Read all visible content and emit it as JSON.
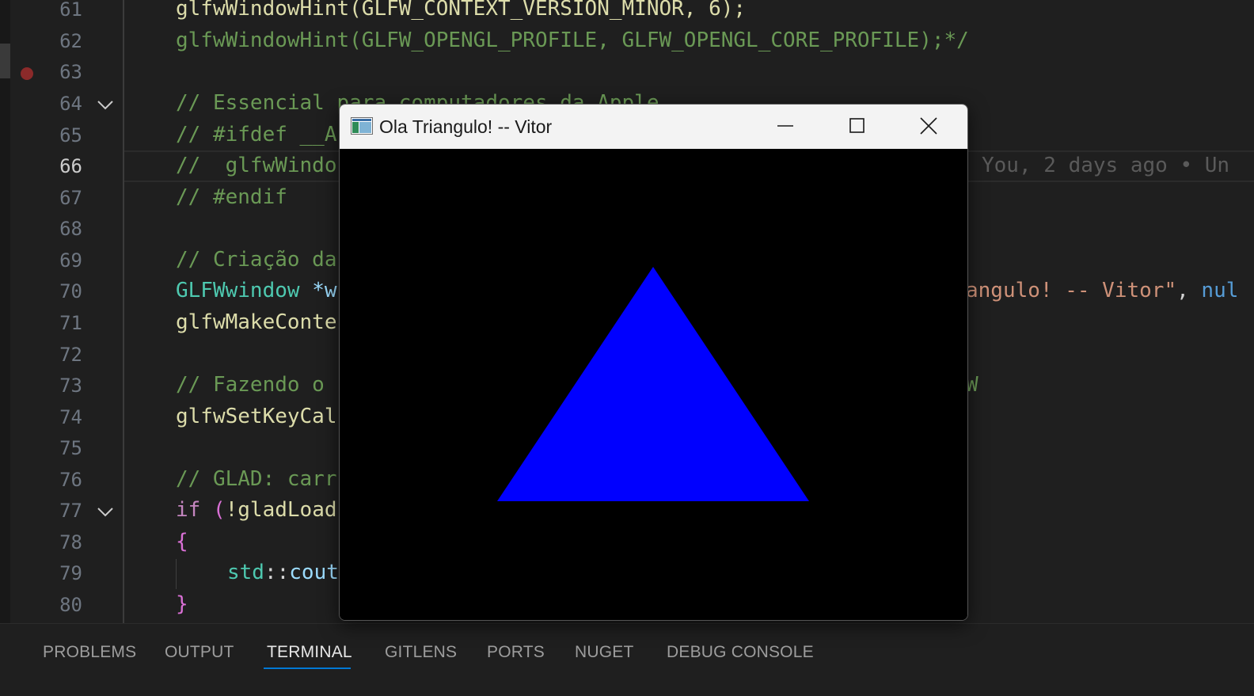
{
  "editor": {
    "lines": [
      {
        "n": "61",
        "code": "glfwWindowHint(GLFW_CONTEXT_VERSION_MINOR, 6);"
      },
      {
        "n": "62",
        "code": "glfwWindowHint(GLFW_OPENGL_PROFILE, GLFW_OPENGL_CORE_PROFILE);*/"
      },
      {
        "n": "63",
        "code": ""
      },
      {
        "n": "64",
        "code": "// Essencial para computadores da Apple"
      },
      {
        "n": "65",
        "code": "// #ifdef __A"
      },
      {
        "n": "66",
        "code": "//  glfwWindo"
      },
      {
        "n": "67",
        "code": "// #endif"
      },
      {
        "n": "68",
        "code": ""
      },
      {
        "n": "69",
        "code": "// Criação da"
      },
      {
        "n": "70",
        "code_type": "GLFWwindow",
        "code_rest": " *w",
        "right_part": "angulo! -- Vitor\"",
        "right_sep": ", ",
        "right_tail": "nul"
      },
      {
        "n": "71",
        "code": "glfwMakeConte"
      },
      {
        "n": "72",
        "code": ""
      },
      {
        "n": "73",
        "code": "// Fazendo o",
        "right": "W"
      },
      {
        "n": "74",
        "code": "glfwSetKeyCal"
      },
      {
        "n": "75",
        "code": ""
      },
      {
        "n": "76",
        "code": "// GLAD: carr"
      },
      {
        "n": "77",
        "code_kw": "if",
        "code_paren": " (",
        "code_rest": "!gladLoad"
      },
      {
        "n": "78",
        "code": "{"
      },
      {
        "n": "79",
        "code_ns": "std",
        "code_sep": "::",
        "code_rest": "cout"
      },
      {
        "n": "80",
        "code": "}"
      }
    ],
    "blame": "You, 2 days ago • Un"
  },
  "panel": {
    "tabs": [
      "PROBLEMS",
      "OUTPUT",
      "TERMINAL",
      "GITLENS",
      "PORTS",
      "NUGET",
      "DEBUG CONSOLE"
    ],
    "active_tab": "TERMINAL"
  },
  "window": {
    "title": "Ola Triangulo! -- Vitor",
    "shape_color": "#0000ff",
    "background": "#000000"
  }
}
